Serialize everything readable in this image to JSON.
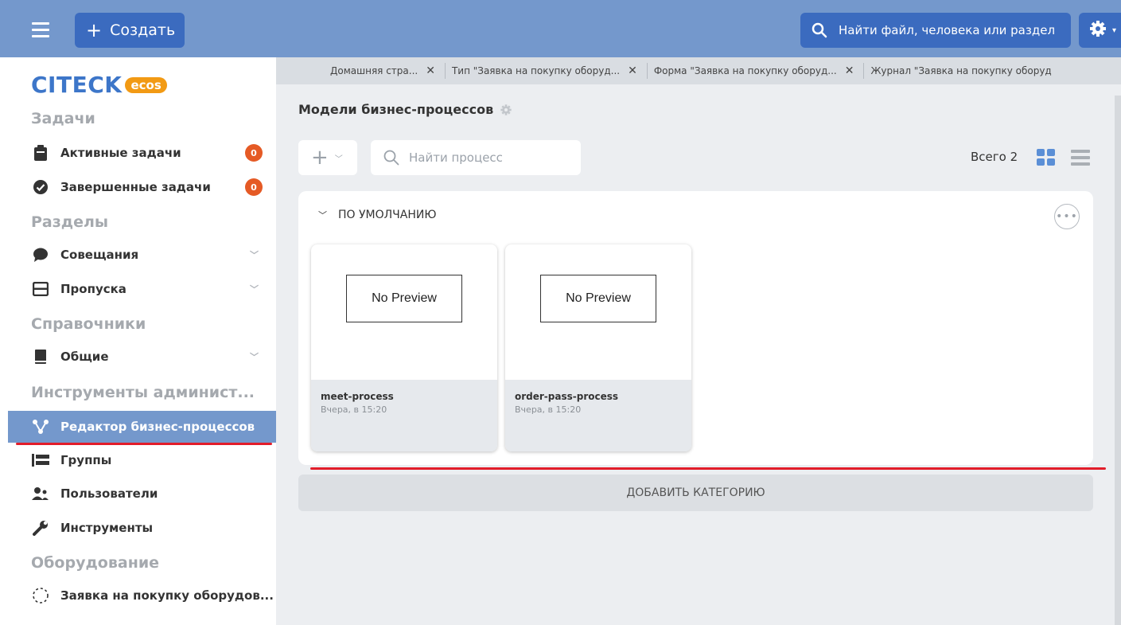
{
  "header": {
    "create_label": "Создать",
    "search_placeholder": "Найти файл, человека или раздел"
  },
  "logo": {
    "word": "CITECK",
    "badge": "ecos"
  },
  "sidebar": {
    "sections": {
      "tasks": "Задачи",
      "sections": "Разделы",
      "directories": "Справочники",
      "admin_tools": "Инструменты админист...",
      "equipment": "Оборудование"
    },
    "items": [
      {
        "label": "Активные задачи",
        "badge": "0"
      },
      {
        "label": "Завершенные задачи",
        "badge": "0"
      },
      {
        "label": "Совещания"
      },
      {
        "label": "Пропуска"
      },
      {
        "label": "Общие"
      },
      {
        "label": "Редактор бизнес-процессов"
      },
      {
        "label": "Группы"
      },
      {
        "label": "Пользователи"
      },
      {
        "label": "Инструменты"
      },
      {
        "label": "Заявка на покупку оборудов..."
      }
    ]
  },
  "tabs": [
    {
      "label": "Домашняя стра..."
    },
    {
      "label": "Тип \"Заявка на покупку оборуд..."
    },
    {
      "label": "Форма \"Заявка на покупку оборуд..."
    },
    {
      "label": "Журнал \"Заявка на покупку оборуд"
    }
  ],
  "main": {
    "title": "Модели бизнес-процессов",
    "search_placeholder": "Найти процесс",
    "total_label": "Всего 2",
    "category_title": "ПО УМОЛЧАНИЮ",
    "add_category_label": "ДОБАВИТЬ КАТЕГОРИЮ",
    "cards": [
      {
        "preview": "No Preview",
        "name": "meet-process",
        "date": "Вчера, в 15:20"
      },
      {
        "preview": "No Preview",
        "name": "order-pass-process",
        "date": "Вчера, в 15:20"
      }
    ]
  }
}
